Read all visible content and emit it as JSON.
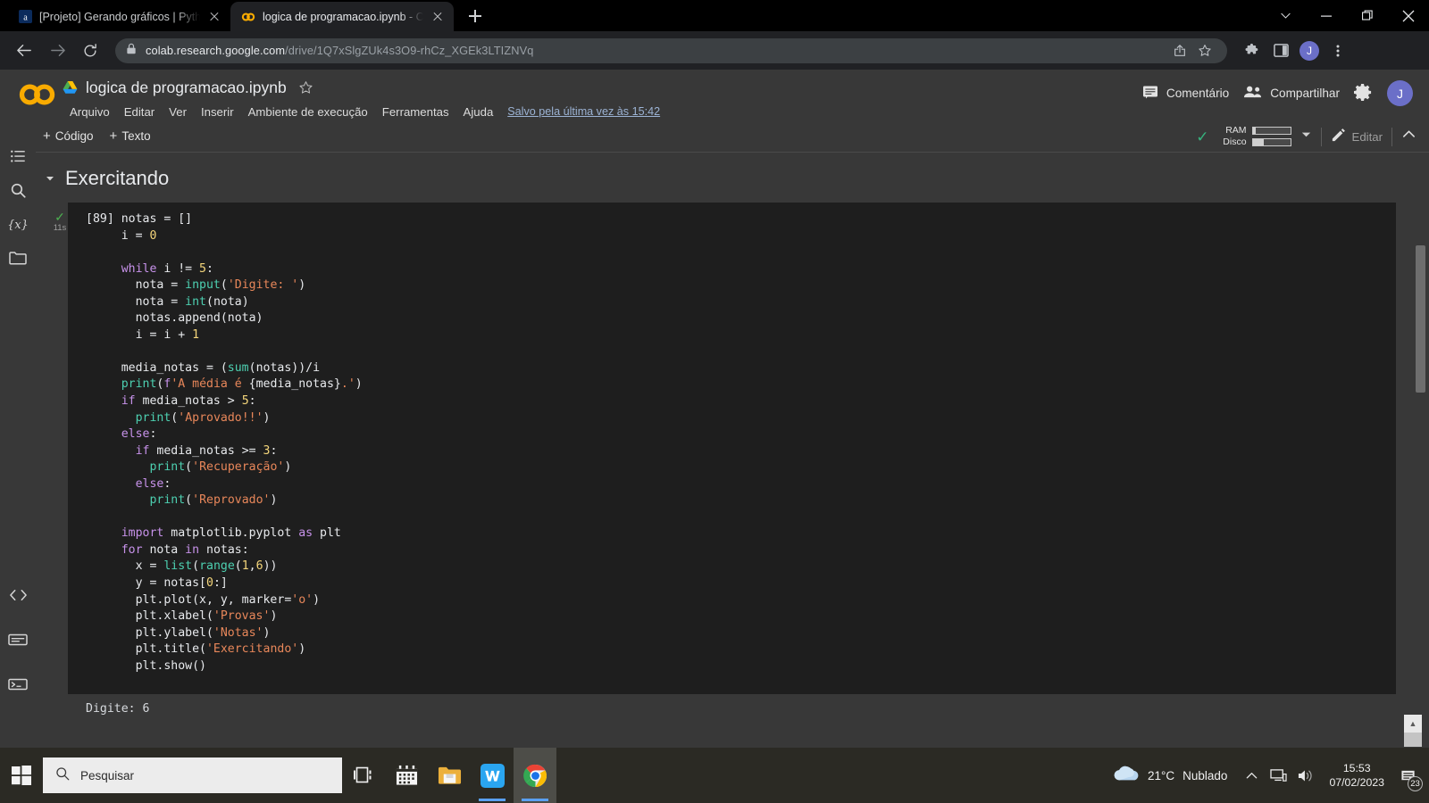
{
  "browser": {
    "tabs": [
      {
        "title": "[Projeto] Gerando gráficos | Pyth",
        "favicon": "alura-icon",
        "active": false
      },
      {
        "title": "logica de programacao.ipynb - C",
        "favicon": "colab-icon",
        "active": true
      }
    ],
    "new_tab_label": "+",
    "window_controls": {
      "minimize_group": "chevron-down",
      "minimize": "minimize",
      "maximize": "restore",
      "close": "close"
    },
    "address": {
      "host": "colab.research.google.com",
      "path": "/drive/1Q7xSlgZUk4s3O9-rhCz_XGEk3LTIZNVq"
    },
    "profile_initial": "J"
  },
  "colab": {
    "notebook_title": "logica de programacao.ipynb",
    "menus": [
      "Arquivo",
      "Editar",
      "Ver",
      "Inserir",
      "Ambiente de execução",
      "Ferramentas",
      "Ajuda"
    ],
    "save_status": "Salvo pela última vez às 15:42",
    "comment_label": "Comentário",
    "share_label": "Compartilhar",
    "avatar_initial": "J",
    "toolbar": {
      "add_code": "Código",
      "add_text": "Texto",
      "plus": "+",
      "ram_label": "RAM",
      "disk_label": "Disco",
      "ram_fill_pct": 8,
      "disk_fill_pct": 30,
      "edit_label": "Editar"
    },
    "sidebar_items": [
      {
        "name": "table-of-contents-icon",
        "label": "Índice"
      },
      {
        "name": "search-icon",
        "label": "Pesquisar"
      },
      {
        "name": "variables-icon",
        "label": "Variáveis"
      },
      {
        "name": "files-icon",
        "label": "Arquivos"
      }
    ],
    "sidebar_bottom_items": [
      {
        "name": "code-snippets-icon",
        "label": "Trechos de código"
      },
      {
        "name": "command-palette-icon",
        "label": "Paleta de comandos"
      },
      {
        "name": "terminal-icon",
        "label": "Terminal"
      }
    ],
    "section_title": "Exercitando",
    "cell": {
      "execution_count": "[89]",
      "run_time": "11s",
      "status": "success"
    },
    "output_text": "Digite: 6"
  },
  "code_lines": [
    [
      {
        "t": "notas = [] ",
        "c": "pl"
      }
    ],
    [
      {
        "t": "i = ",
        "c": "pl"
      },
      {
        "t": "0",
        "c": "num"
      }
    ],
    [],
    [
      {
        "t": "while",
        "c": "kw"
      },
      {
        "t": " i != ",
        "c": "pl"
      },
      {
        "t": "5",
        "c": "num"
      },
      {
        "t": ":",
        "c": "pl"
      }
    ],
    [
      {
        "t": "  nota = ",
        "c": "pl"
      },
      {
        "t": "input",
        "c": "bi"
      },
      {
        "t": "(",
        "c": "pl"
      },
      {
        "t": "'Digite: '",
        "c": "str"
      },
      {
        "t": ")",
        "c": "pl"
      }
    ],
    [
      {
        "t": "  nota = ",
        "c": "pl"
      },
      {
        "t": "int",
        "c": "bi"
      },
      {
        "t": "(nota)",
        "c": "pl"
      }
    ],
    [
      {
        "t": "  notas.append(nota)",
        "c": "pl"
      }
    ],
    [
      {
        "t": "  i = i + ",
        "c": "pl"
      },
      {
        "t": "1",
        "c": "num"
      }
    ],
    [],
    [
      {
        "t": "media_notas = (",
        "c": "pl"
      },
      {
        "t": "sum",
        "c": "bi"
      },
      {
        "t": "(notas))/i",
        "c": "pl"
      }
    ],
    [
      {
        "t": "print",
        "c": "bi"
      },
      {
        "t": "(",
        "c": "pl"
      },
      {
        "t": "f",
        "c": "fstr"
      },
      {
        "t": "'A média é ",
        "c": "str"
      },
      {
        "t": "{media_notas}",
        "c": "pl"
      },
      {
        "t": ".'",
        "c": "str"
      },
      {
        "t": ")",
        "c": "pl"
      }
    ],
    [
      {
        "t": "if",
        "c": "kw"
      },
      {
        "t": " media_notas > ",
        "c": "pl"
      },
      {
        "t": "5",
        "c": "num"
      },
      {
        "t": ":",
        "c": "pl"
      }
    ],
    [
      {
        "t": "  ",
        "c": "pl"
      },
      {
        "t": "print",
        "c": "bi"
      },
      {
        "t": "(",
        "c": "pl"
      },
      {
        "t": "'Aprovado!!'",
        "c": "str"
      },
      {
        "t": ")",
        "c": "pl"
      }
    ],
    [
      {
        "t": "else",
        "c": "kw"
      },
      {
        "t": ":",
        "c": "pl"
      }
    ],
    [
      {
        "t": "  ",
        "c": "pl"
      },
      {
        "t": "if",
        "c": "kw"
      },
      {
        "t": " media_notas >= ",
        "c": "pl"
      },
      {
        "t": "3",
        "c": "num"
      },
      {
        "t": ":",
        "c": "pl"
      }
    ],
    [
      {
        "t": "    ",
        "c": "pl"
      },
      {
        "t": "print",
        "c": "bi"
      },
      {
        "t": "(",
        "c": "pl"
      },
      {
        "t": "'Recuperação'",
        "c": "str"
      },
      {
        "t": ")",
        "c": "pl"
      }
    ],
    [
      {
        "t": "  ",
        "c": "pl"
      },
      {
        "t": "else",
        "c": "kw"
      },
      {
        "t": ":",
        "c": "pl"
      }
    ],
    [
      {
        "t": "    ",
        "c": "pl"
      },
      {
        "t": "print",
        "c": "bi"
      },
      {
        "t": "(",
        "c": "pl"
      },
      {
        "t": "'Reprovado'",
        "c": "str"
      },
      {
        "t": ")",
        "c": "pl"
      }
    ],
    [],
    [
      {
        "t": "import",
        "c": "kw"
      },
      {
        "t": " matplotlib.pyplot ",
        "c": "pl"
      },
      {
        "t": "as",
        "c": "kw"
      },
      {
        "t": " plt",
        "c": "pl"
      }
    ],
    [
      {
        "t": "for",
        "c": "kw"
      },
      {
        "t": " nota ",
        "c": "pl"
      },
      {
        "t": "in",
        "c": "kw"
      },
      {
        "t": " notas:",
        "c": "pl"
      }
    ],
    [
      {
        "t": "  x = ",
        "c": "pl"
      },
      {
        "t": "list",
        "c": "bi"
      },
      {
        "t": "(",
        "c": "pl"
      },
      {
        "t": "range",
        "c": "bi"
      },
      {
        "t": "(",
        "c": "pl"
      },
      {
        "t": "1",
        "c": "num"
      },
      {
        "t": ",",
        "c": "pl"
      },
      {
        "t": "6",
        "c": "num"
      },
      {
        "t": "))",
        "c": "pl"
      }
    ],
    [
      {
        "t": "  y = notas[",
        "c": "pl"
      },
      {
        "t": "0",
        "c": "num"
      },
      {
        "t": ":]",
        "c": "pl"
      }
    ],
    [
      {
        "t": "  plt.plot(x, y, marker=",
        "c": "pl"
      },
      {
        "t": "'o'",
        "c": "str"
      },
      {
        "t": ")",
        "c": "pl"
      }
    ],
    [
      {
        "t": "  plt.xlabel(",
        "c": "pl"
      },
      {
        "t": "'Provas'",
        "c": "str"
      },
      {
        "t": ")",
        "c": "pl"
      }
    ],
    [
      {
        "t": "  plt.ylabel(",
        "c": "pl"
      },
      {
        "t": "'Notas'",
        "c": "str"
      },
      {
        "t": ")",
        "c": "pl"
      }
    ],
    [
      {
        "t": "  plt.title(",
        "c": "pl"
      },
      {
        "t": "'Exercitando'",
        "c": "str"
      },
      {
        "t": ")",
        "c": "pl"
      }
    ],
    [
      {
        "t": "  plt.show()",
        "c": "pl"
      }
    ]
  ],
  "taskbar": {
    "search_placeholder": "Pesquisar",
    "apps": [
      {
        "name": "task-view-icon",
        "label": "Visão de tarefas"
      },
      {
        "name": "calendar-icon",
        "label": "Calendário"
      },
      {
        "name": "file-explorer-icon",
        "label": "Explorador de Arquivos"
      },
      {
        "name": "wps-writer-icon",
        "label": "WPS Writer"
      },
      {
        "name": "chrome-icon",
        "label": "Google Chrome"
      }
    ],
    "weather": {
      "temperature": "21°C",
      "condition": "Nublado"
    },
    "clock": {
      "time": "15:53",
      "date": "07/02/2023"
    },
    "notification_count": "23"
  },
  "colors": {
    "accent": "#6b6fc8",
    "colab_orange": "#f9ab00",
    "success_green": "#36b37e",
    "code_bg": "#1e1e1e",
    "page_bg": "#383838",
    "browser_bg": "#202124"
  }
}
